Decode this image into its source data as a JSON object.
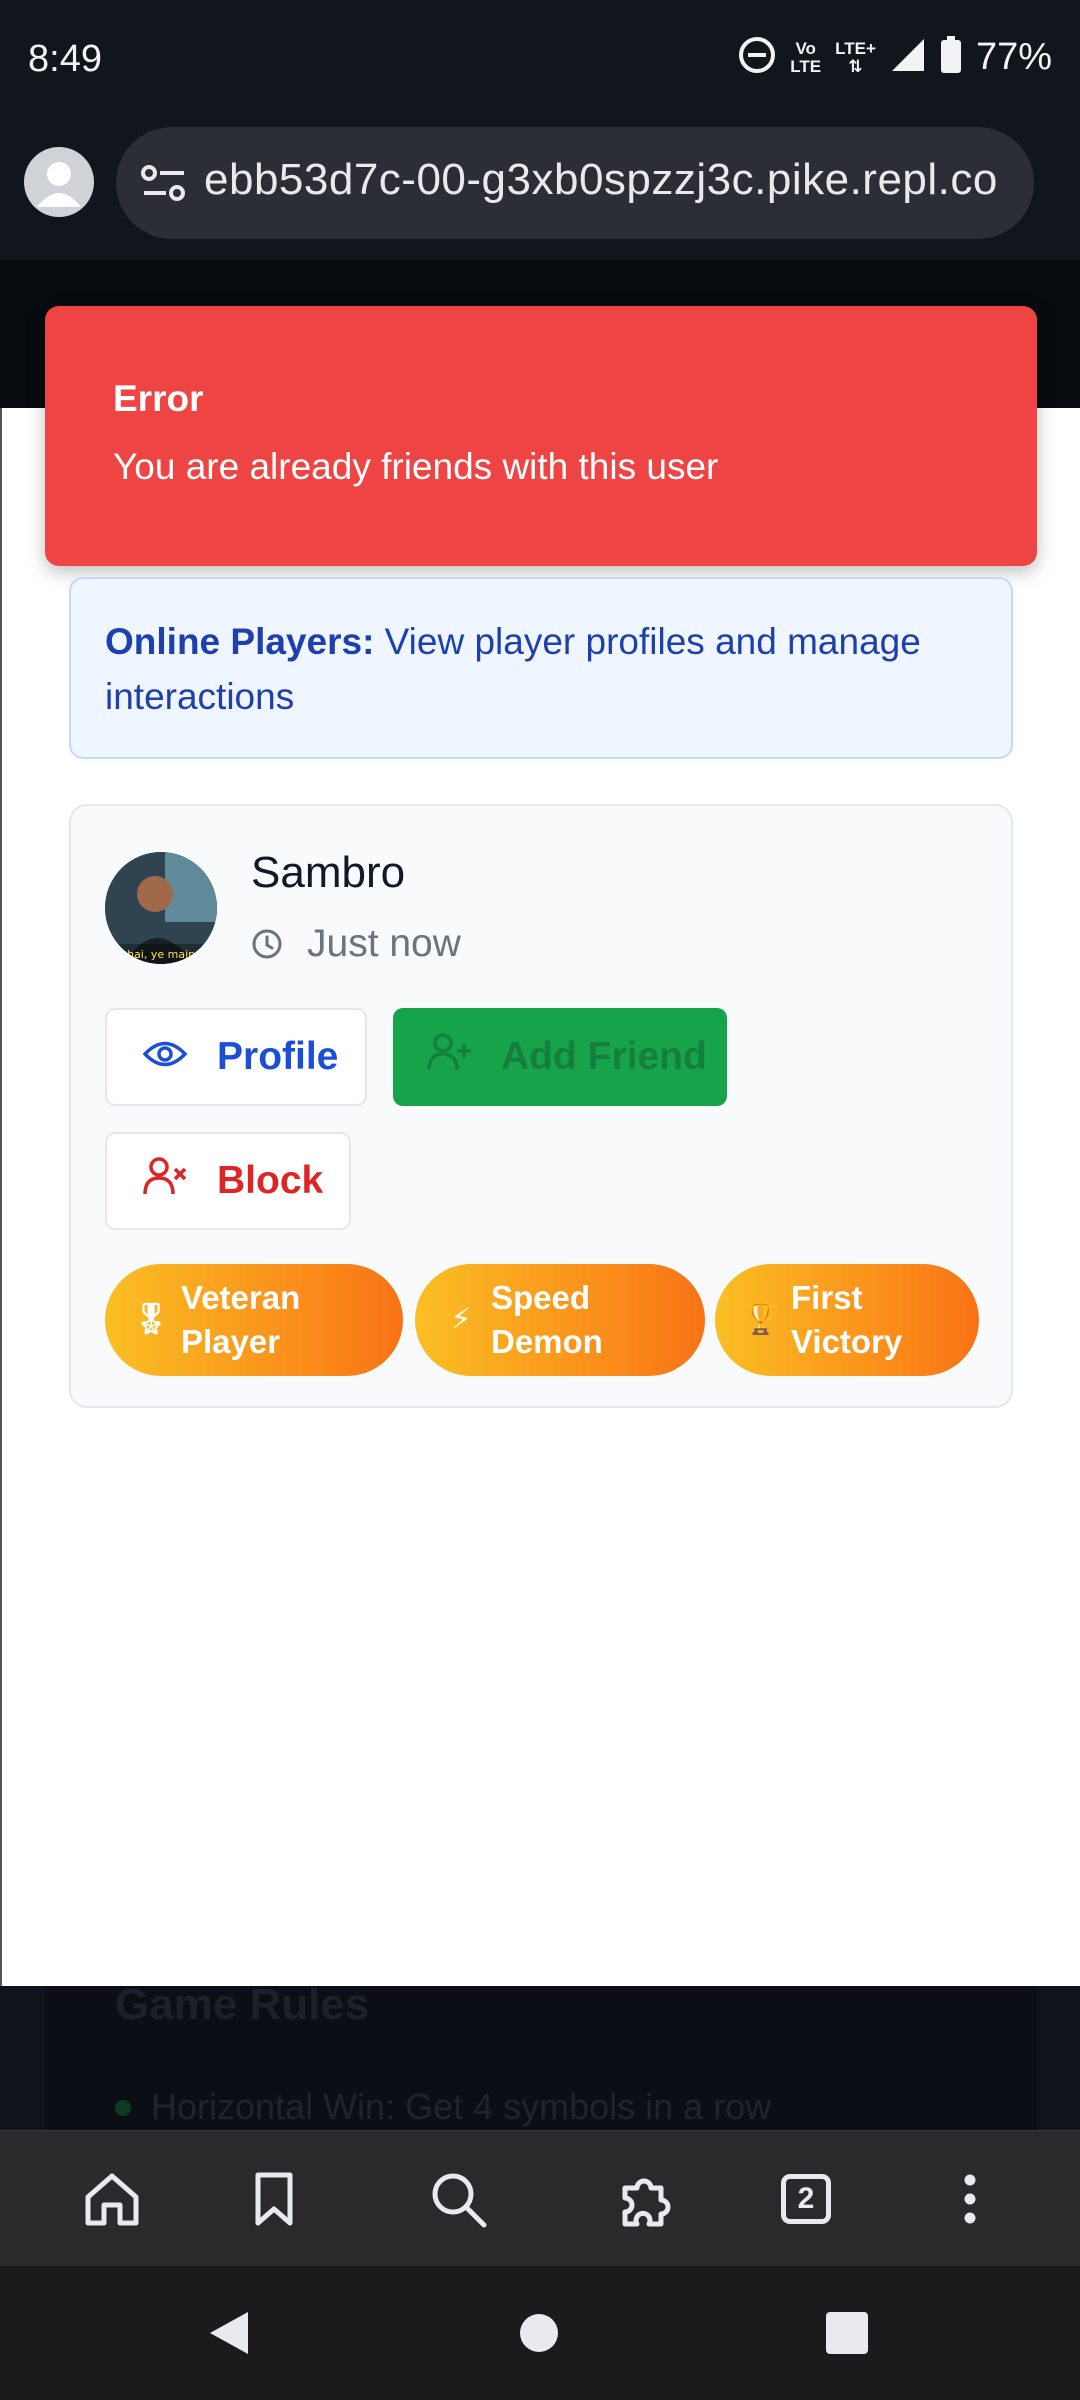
{
  "status_bar": {
    "time": "8:49",
    "volte_label_top": "Vo",
    "volte_label_bottom": "LTE",
    "network_label": "LTE+",
    "battery": "77%"
  },
  "browser": {
    "url": "ebb53d7c-00-g3xb0spzzj3c.pike.repl.co",
    "tab_count": "2"
  },
  "toast": {
    "title": "Error",
    "message": "You are already friends with this user"
  },
  "info_banner": {
    "label": "Online Players:",
    "text": " View player profiles and manage interactions"
  },
  "player": {
    "name": "Sambro",
    "last_seen": "Just now",
    "avatar_caption": "bhai, ye maine"
  },
  "actions": {
    "profile": "Profile",
    "add_friend": "Add Friend",
    "block": "Block"
  },
  "badges": [
    {
      "icon": "🎖",
      "line1": "Veteran",
      "line2": "Player"
    },
    {
      "icon": "⚡",
      "line1": "Speed",
      "line2": "Demon"
    },
    {
      "icon": "🏆",
      "line1": "First",
      "line2": "Victory"
    }
  ],
  "background_rules": {
    "title": "Game Rules",
    "item": "Horizontal Win: Get 4 symbols in a row"
  },
  "colors": {
    "error": "#ef4444",
    "info_bg": "#eff6ff",
    "info_text": "#1e40af",
    "add_friend": "#16a34a",
    "block": "#dc2626",
    "profile": "#1d4ed8"
  }
}
